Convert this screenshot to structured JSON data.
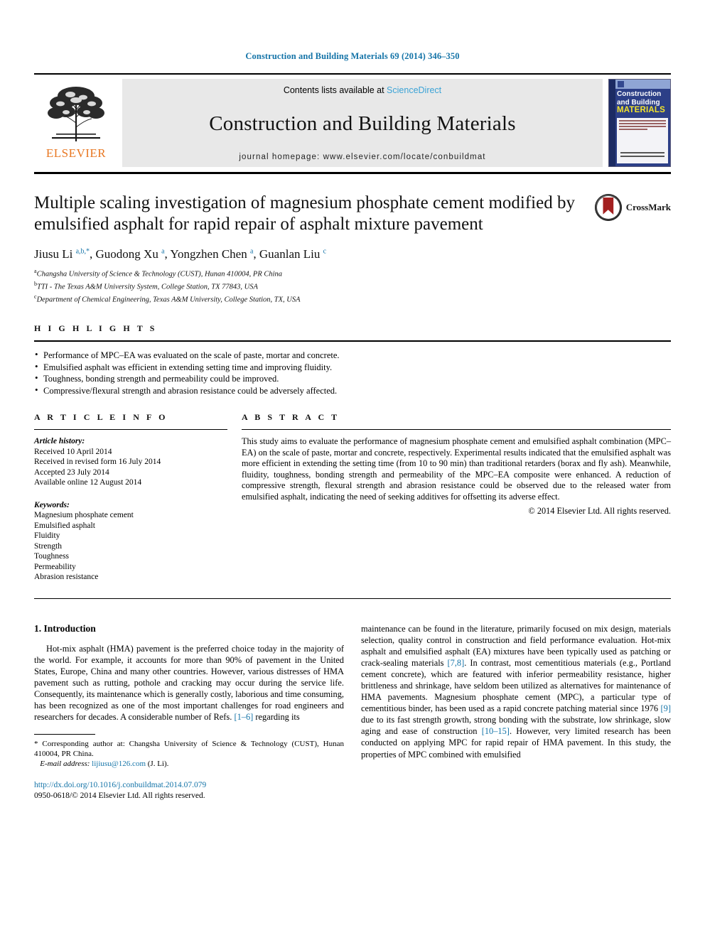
{
  "running_head": "Construction and Building Materials 69 (2014) 346–350",
  "masthead": {
    "publisher": "ELSEVIER",
    "contents_prefix": "Contents lists available at ",
    "sciencedirect": "ScienceDirect",
    "journal_title": "Construction and Building Materials",
    "homepage": "journal homepage: www.elsevier.com/locate/conbuildmat",
    "cover": {
      "line1": "Construction",
      "line2": "and Building",
      "line3": "MATERIALS"
    }
  },
  "article": {
    "title": "Multiple scaling investigation of magnesium phosphate cement modified by emulsified asphalt for rapid repair of asphalt mixture pavement",
    "crossmark_label": "CrossMark",
    "authors_html": "Jiusu Li <sup>a,b,*</sup>, Guodong Xu <sup>a</sup>, Yongzhen Chen <sup>a</sup>, Guanlan Liu <sup>c</sup>",
    "affiliations": [
      "Changsha University of Science & Technology (CUST), Hunan 410004, PR China",
      "TTI - The Texas A&M University System, College Station, TX 77843, USA",
      "Department of Chemical Engineering, Texas A&M University, College Station, TX, USA"
    ],
    "affiliation_marks": [
      "a",
      "b",
      "c"
    ]
  },
  "highlights": {
    "label": "H I G H L I G H T S",
    "items": [
      "Performance of MPC–EA was evaluated on the scale of paste, mortar and concrete.",
      "Emulsified asphalt was efficient in extending setting time and improving fluidity.",
      "Toughness, bonding strength and permeability could be improved.",
      "Compressive/flexural strength and abrasion resistance could be adversely affected."
    ]
  },
  "article_info": {
    "label": "A R T I C L E    I N F O",
    "history_label": "Article history:",
    "history": [
      "Received 10 April 2014",
      "Received in revised form 16 July 2014",
      "Accepted 23 July 2014",
      "Available online 12 August 2014"
    ],
    "keywords_label": "Keywords:",
    "keywords": [
      "Magnesium phosphate cement",
      "Emulsified asphalt",
      "Fluidity",
      "Strength",
      "Toughness",
      "Permeability",
      "Abrasion resistance"
    ]
  },
  "abstract": {
    "label": "A B S T R A C T",
    "text": "This study aims to evaluate the performance of magnesium phosphate cement and emulsified asphalt combination (MPC–EA) on the scale of paste, mortar and concrete, respectively. Experimental results indicated that the emulsified asphalt was more efficient in extending the setting time (from 10 to 90 min) than traditional retarders (borax and fly ash). Meanwhile, fluidity, toughness, bonding strength and permeability of the MPC–EA composite were enhanced. A reduction of compressive strength, flexural strength and abrasion resistance could be observed due to the released water from emulsified asphalt, indicating the need of seeking additives for offsetting its adverse effect.",
    "copyright": "© 2014 Elsevier Ltd. All rights reserved."
  },
  "introduction": {
    "heading": "1. Introduction",
    "left_paragraph_part1": "Hot-mix asphalt (HMA) pavement is the preferred choice today in the majority of the world. For example, it accounts for more than 90% of pavement in the United States, Europe, China and many other countries. However, various distresses of HMA pavement such as rutting, pothole and cracking may occur during the service life. Consequently, its maintenance which is generally costly, laborious and time consuming, has been recognized as one of the most important challenges for road engineers and researchers for decades. A considerable number of Refs. ",
    "left_ref1": "[1–6]",
    "left_paragraph_part2": " regarding its",
    "right_part1": "maintenance can be found in the literature, primarily focused on mix design, materials selection, quality control in construction and field performance evaluation. Hot-mix asphalt and emulsified asphalt (EA) mixtures have been typically used as patching or crack-sealing materials ",
    "right_ref1": "[7,8]",
    "right_part2": ". In contrast, most cementitious materials (e.g., Portland cement concrete), which are featured with inferior permeability resistance, higher brittleness and shrinkage, have seldom been utilized as alternatives for maintenance of HMA pavements. Magnesium phosphate cement (MPC), a particular type of cementitious binder, has been used as a rapid concrete patching material since 1976 ",
    "right_ref2": "[9]",
    "right_part3": " due to its fast strength growth, strong bonding with the substrate, low shrinkage, slow aging and ease of construction ",
    "right_ref3": "[10–15]",
    "right_part4": ". However, very limited research has been conducted on applying MPC for rapid repair of HMA pavement. In this study, the properties of MPC combined with emulsified"
  },
  "footnote": {
    "corresponding": "* Corresponding author at: Changsha University of Science & Technology (CUST), Hunan 410004, PR China.",
    "email_label": "E-mail address:",
    "email": "lijiusu@126.com",
    "email_suffix": "(J. Li)."
  },
  "doi": {
    "url": "http://dx.doi.org/10.1016/j.conbuildmat.2014.07.079",
    "issn_line": "0950-0618/© 2014 Elsevier Ltd. All rights reserved."
  },
  "colors": {
    "link_blue": "#1574a8",
    "sciencedirect_blue": "#3ba3d6",
    "elsevier_orange": "#e87722",
    "cover_blue": "#2c3f87",
    "cover_yellow": "#f2e32b",
    "crossmark_red": "#a32020"
  }
}
